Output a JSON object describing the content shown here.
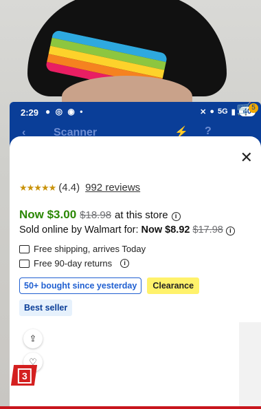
{
  "status_bar": {
    "time": "2:29",
    "network": "5G",
    "battery": "40"
  },
  "app_bar": {
    "title": "Scanner",
    "cart_count": "5"
  },
  "product": {
    "rating": "(4.4)",
    "reviews": "992 reviews",
    "now_price": "Now $3.00",
    "was_price": "$18.98",
    "at_store": "at this store",
    "online_label": "Sold online by Walmart for:",
    "online_now": "Now $8.92",
    "online_was": "$17.98",
    "shipping": "Free shipping, arrives Today",
    "returns": "Free 90-day returns"
  },
  "badges": {
    "bought": "50+ bought since yesterday",
    "clearance": "Clearance",
    "best_seller": "Best seller"
  },
  "overlay": {
    "number_label": "3"
  },
  "colors": {
    "brand_blue": "#0a3e98",
    "price_green": "#2a8703",
    "badge_blue": "#1f5fd1",
    "clearance_yellow": "#fff26b"
  }
}
